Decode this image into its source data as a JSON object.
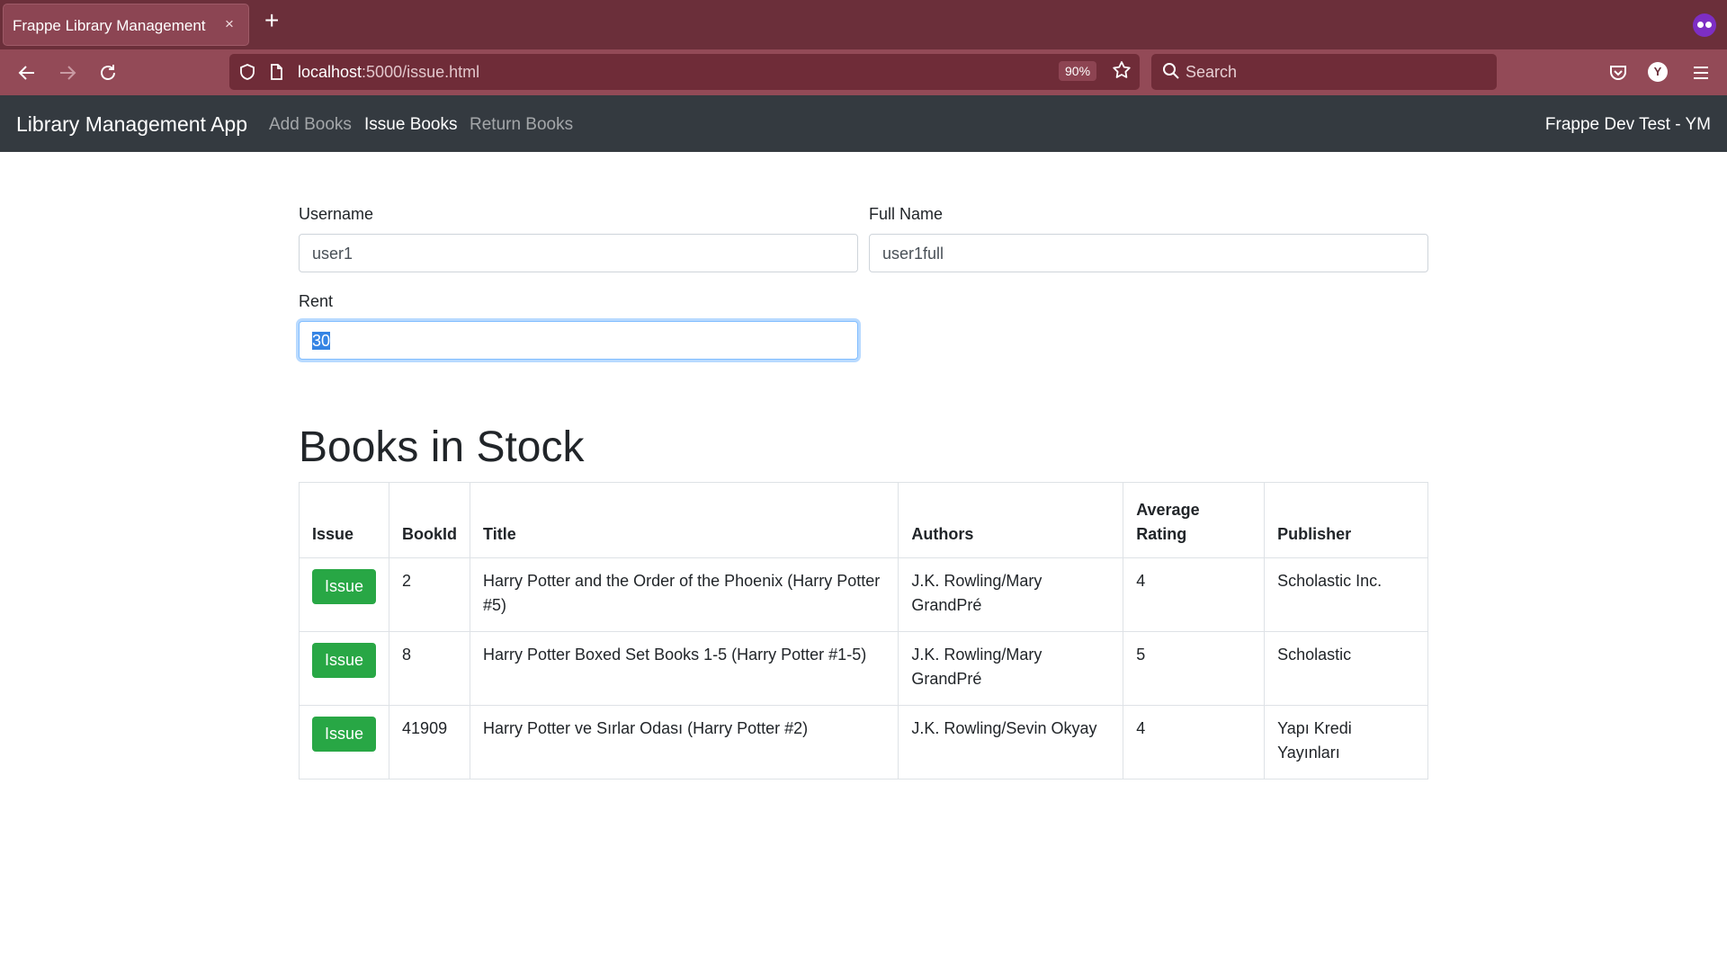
{
  "browser": {
    "tab_title": "Frappe Library Management",
    "tab_close": "×",
    "new_tab": "+",
    "url_host": "localhost",
    "url_path": ":5000/issue.html",
    "zoom": "90%",
    "search_placeholder": "Search",
    "avatar_letter": "Y",
    "colors": {
      "tabbar": "#6b2f3a",
      "toolbar": "#934a57",
      "urlbar": "#6f2c38"
    }
  },
  "navbar": {
    "brand": "Library Management App",
    "links": [
      {
        "label": "Add Books",
        "active": false
      },
      {
        "label": "Issue Books",
        "active": true
      },
      {
        "label": "Return Books",
        "active": false
      }
    ],
    "right_text": "Frappe Dev Test - YM"
  },
  "form": {
    "username": {
      "label": "Username",
      "value": "user1"
    },
    "full_name": {
      "label": "Full Name",
      "value": "user1full"
    },
    "rent": {
      "label": "Rent",
      "value": "30"
    }
  },
  "books_section": {
    "title": "Books in Stock",
    "columns": [
      "Issue",
      "BookId",
      "Title",
      "Authors",
      "Average Rating",
      "Publisher"
    ],
    "rows": [
      {
        "button": "Issue",
        "book_id": "2",
        "title": "Harry Potter and the Order of the Phoenix (Harry Potter #5)",
        "authors": "J.K. Rowling/Mary GrandPré",
        "rating": "4",
        "publisher": "Scholastic Inc."
      },
      {
        "button": "Issue",
        "book_id": "8",
        "title": "Harry Potter Boxed Set Books 1-5 (Harry Potter #1-5)",
        "authors": "J.K. Rowling/Mary GrandPré",
        "rating": "5",
        "publisher": "Scholastic"
      },
      {
        "button": "Issue",
        "book_id": "41909",
        "title": "Harry Potter ve Sırlar Odası (Harry Potter #2)",
        "authors": "J.K. Rowling/Sevin Okyay",
        "rating": "4",
        "publisher": "Yapı Kredi Yayınları"
      }
    ],
    "button_color": "#28a745"
  }
}
